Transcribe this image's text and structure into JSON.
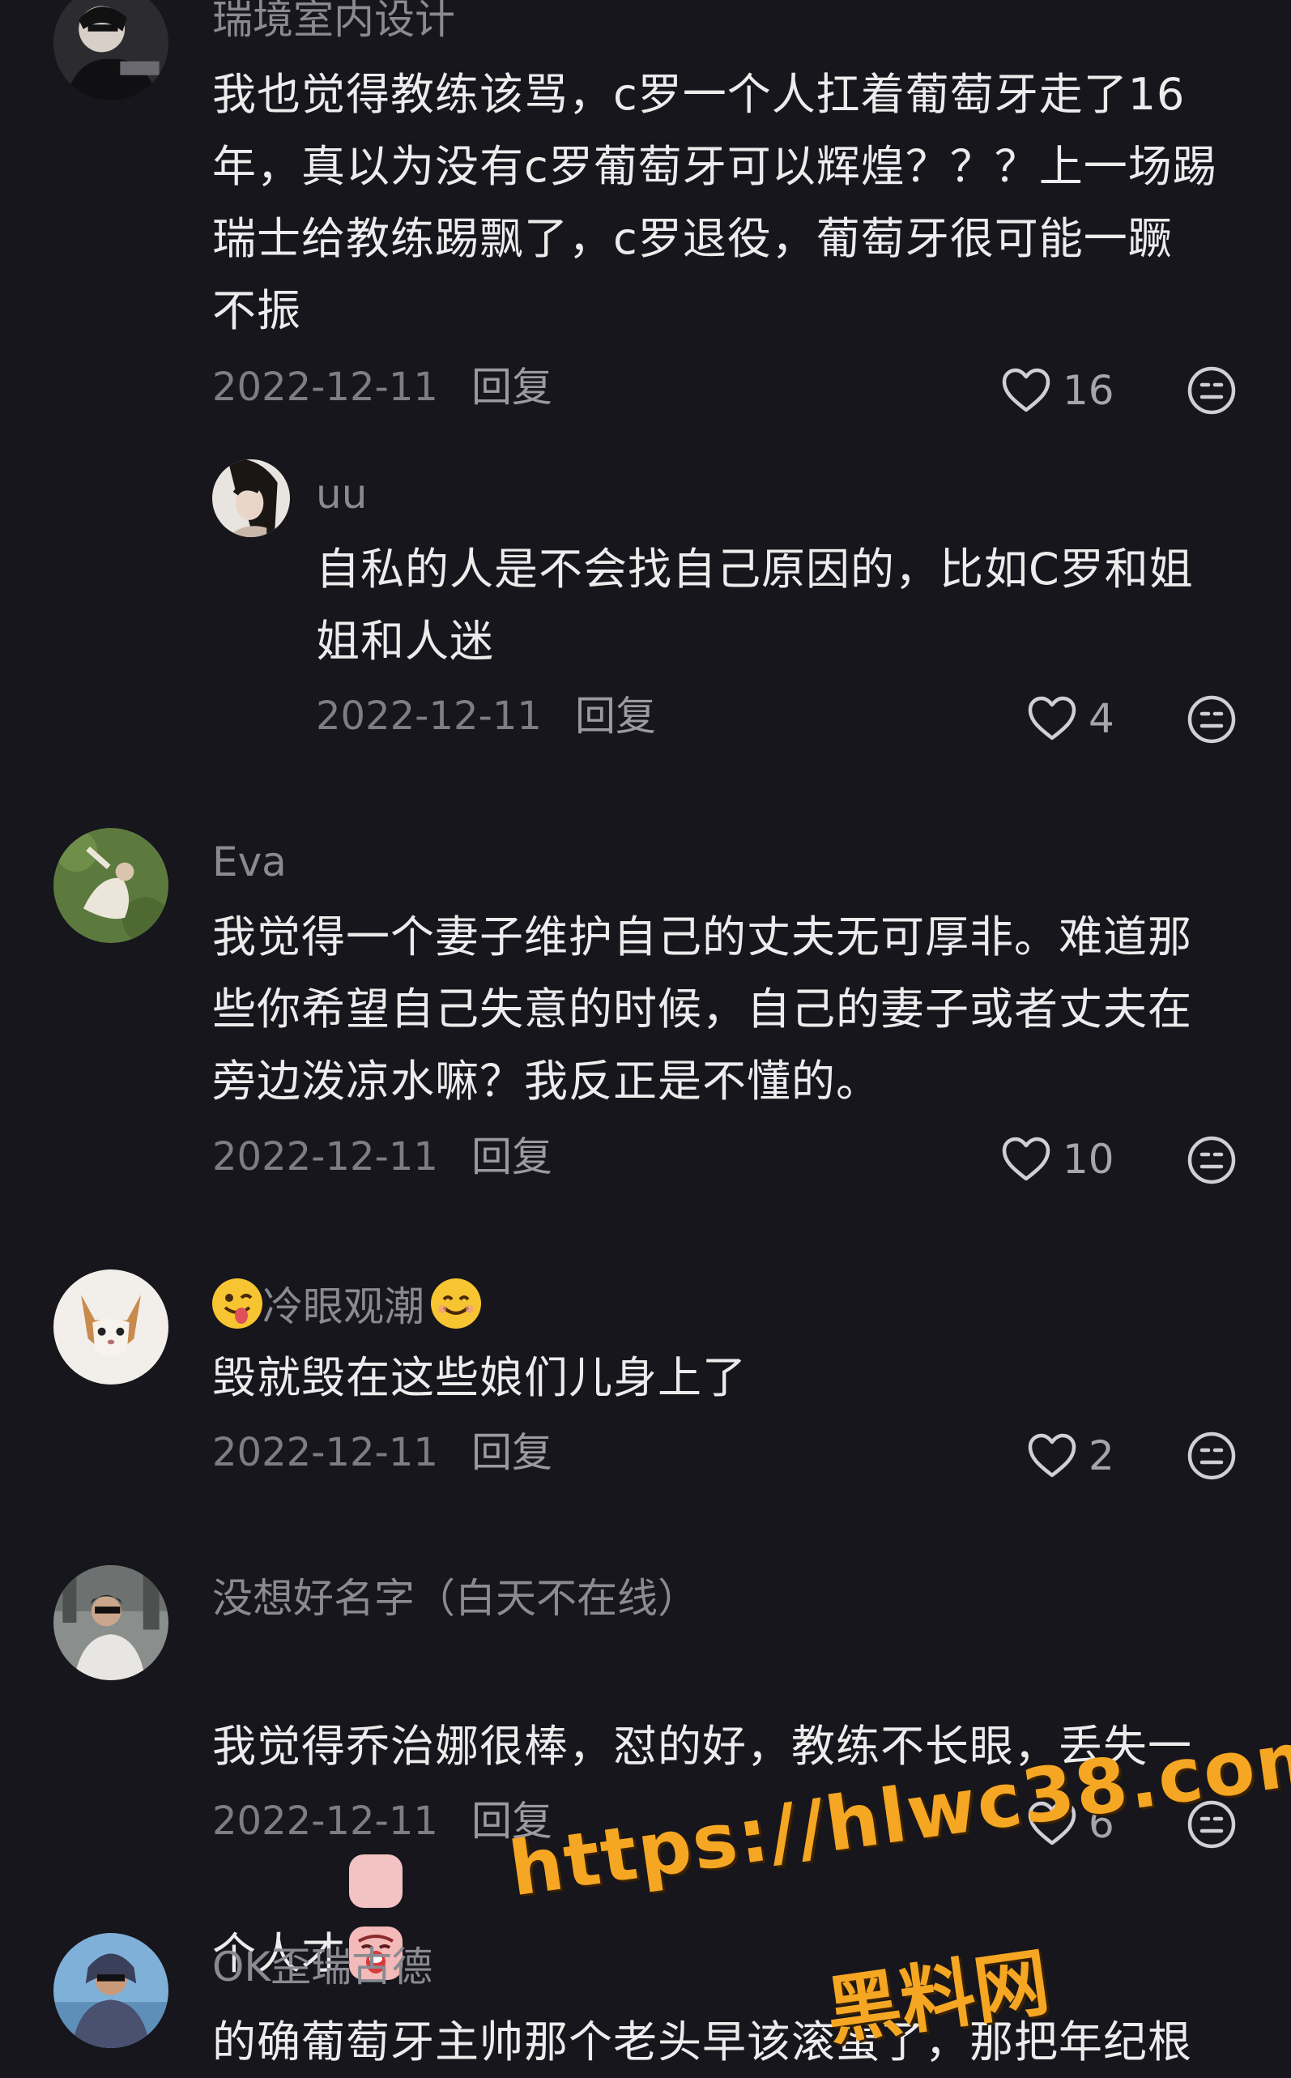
{
  "comments": [
    {
      "username": "瑞境室内设计",
      "body": "我也觉得教练该骂，c罗一个人扛着葡萄牙走了16\n年，真以为没有c罗葡萄牙可以辉煌？？？上一场踢\n瑞士给教练踢飘了，c罗退役，葡萄牙很可能一蹶\n不振",
      "date": "2022-12-11",
      "reply_label": "回复",
      "likes": "16"
    },
    {
      "username": "uu",
      "body": "自私的人是不会找自己原因的，比如C罗和姐\n姐和人迷",
      "date": "2022-12-11",
      "reply_label": "回复",
      "likes": "4"
    },
    {
      "username": "Eva",
      "body": "我觉得一个妻子维护自己的丈夫无可厚非。难道那\n些你希望自己失意的时候，自己的妻子或者丈夫在\n旁边泼凉水嘛？我反正是不懂的。",
      "date": "2022-12-11",
      "reply_label": "回复",
      "likes": "10"
    },
    {
      "username": "冷眼观潮",
      "body": "毁就毁在这些娘们儿身上了",
      "date": "2022-12-11",
      "reply_label": "回复",
      "likes": "2"
    },
    {
      "username": "没想好名字（白天不在线）",
      "body_line1": "我觉得乔治娜很棒，怼的好，教练不长眼，丢失一",
      "body_line2": "个人才",
      "date": "2022-12-11",
      "reply_label": "回复",
      "likes": "6"
    },
    {
      "username": "OK歪瑞古德",
      "body": "的确葡萄牙主帅那个老头早该滚蛋了，那把年纪根"
    }
  ],
  "icons": {
    "like": "heart-outline-icon",
    "dislike": "unhappy-face-icon"
  },
  "watermark": {
    "line1": "https://hlwc38.com",
    "line2": "黑料网",
    "color": "#f5a623"
  }
}
